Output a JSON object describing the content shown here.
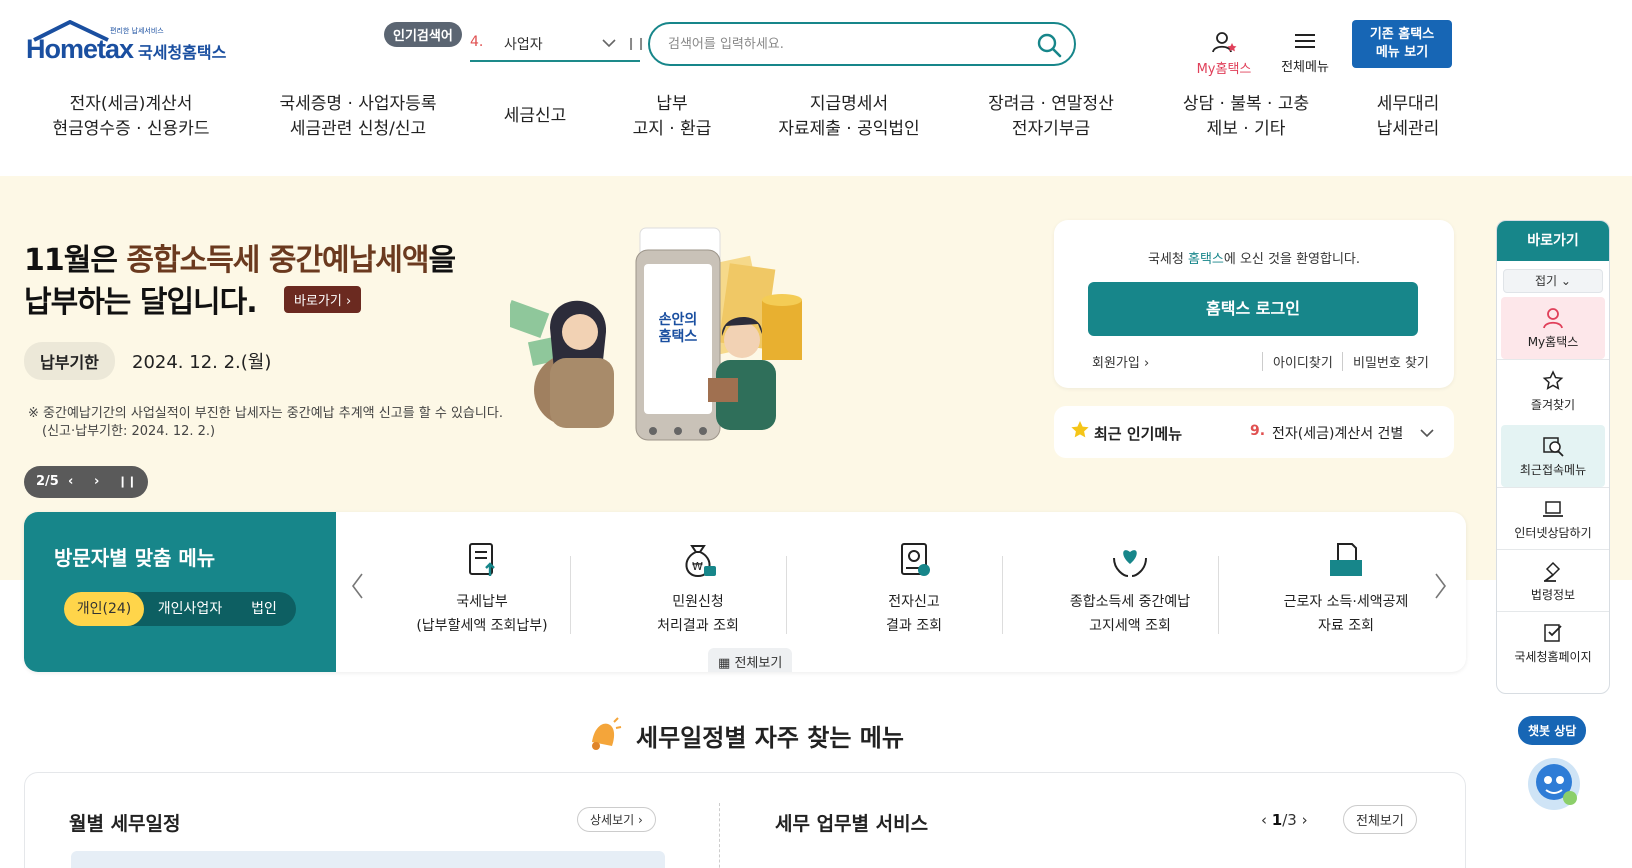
{
  "header": {
    "logo_word": "Hometax",
    "logo_sub": "편리한 납세서비스",
    "logo_name": "국세청홈택스",
    "popular_badge": "인기검색어",
    "popular_rank": "4.",
    "popular_term": "사업자",
    "search_placeholder": "검색어를 입력하세요.",
    "my_hometax": "My홈택스",
    "all_menu": "전체메뉴",
    "old_hometax_line1": "기존 홈택스",
    "old_hometax_line2": "메뉴 보기"
  },
  "gnb": [
    {
      "line1": "전자(세금)계산서",
      "line2": "현금영수증 · 신용카드"
    },
    {
      "line1": "국세증명 · 사업자등록",
      "line2": "세금관련 신청/신고"
    },
    {
      "line1": "세금신고",
      "line2": ""
    },
    {
      "line1": "납부",
      "line2": "고지 · 환급"
    },
    {
      "line1": "지급명세서",
      "line2": "자료제출 · 공익법인"
    },
    {
      "line1": "장려금 · 연말정산",
      "line2": "전자기부금"
    },
    {
      "line1": "상담 · 불복 · 고충",
      "line2": "제보 · 기타"
    },
    {
      "line1": "세무대리",
      "line2": "납세관리"
    }
  ],
  "hero": {
    "title_pre": "11월은 ",
    "title_highlight": "종합소득세 중간예납세액",
    "title_post": "을",
    "title_line2": "납부하는 달입니다.",
    "go_button": "바로가기",
    "due_label": "납부기한",
    "due_date": "2024. 12. 2.(월)",
    "notice_line1": "※ 중간예납기간의 사업실적이 부진한 납세자는 중간예납 추계액 신고를 할 수 있습니다.",
    "notice_line2": "(신고·납부기한: 2024. 12. 2.)",
    "slide_counter": "2/5",
    "phone_text_line1": "손안의",
    "phone_text_line2": "홈택스"
  },
  "login_card": {
    "welcome_pre": "국세청 ",
    "welcome_highlight": "홈택스",
    "welcome_post": "에 오신 것을 환영합니다.",
    "login_button": "홈택스 로그인",
    "join": "회원가입",
    "find_id": "아이디찾기",
    "find_pw": "비밀번호 찾기"
  },
  "recent_popular": {
    "label": "최근 인기메뉴",
    "rank": "9.",
    "item": "전자(세금)계산서 건별"
  },
  "visitor_menu": {
    "title": "방문자별 맞춤 메뉴",
    "tabs": [
      "개인(24)",
      "개인사업자",
      "법인"
    ],
    "items": [
      {
        "line1": "국세납부",
        "line2": "(납부할세액 조회납부)"
      },
      {
        "line1": "민원신청",
        "line2": "처리결과 조회"
      },
      {
        "line1": "전자신고",
        "line2": "결과 조회"
      },
      {
        "line1": "종합소득세 중간예납",
        "line2": "고지세액 조회"
      },
      {
        "line1": "근로자 소득·세액공제",
        "line2": "자료 조회"
      }
    ],
    "view_all": "전체보기"
  },
  "quick_bar": {
    "title": "바로가기",
    "fold": "접기",
    "items": [
      "My홈택스",
      "즐겨찾기",
      "최근접속메뉴",
      "인터넷상담하기",
      "법령정보",
      "국세청홈페이지"
    ]
  },
  "chatbot": {
    "label": "챗봇 상담"
  },
  "schedule": {
    "section_title": "세무일정별 자주 찾는 메뉴",
    "monthly_title": "월별 세무일정",
    "detail_button": "상세보기",
    "business_title": "세무 업무별 서비스",
    "page_current": "1",
    "page_total": "3",
    "view_all": "전체보기"
  },
  "colors": {
    "primary": "#17868a",
    "blue": "#1766b5",
    "accent": "#e0405a",
    "hero_bg": "#fdf8e6"
  }
}
